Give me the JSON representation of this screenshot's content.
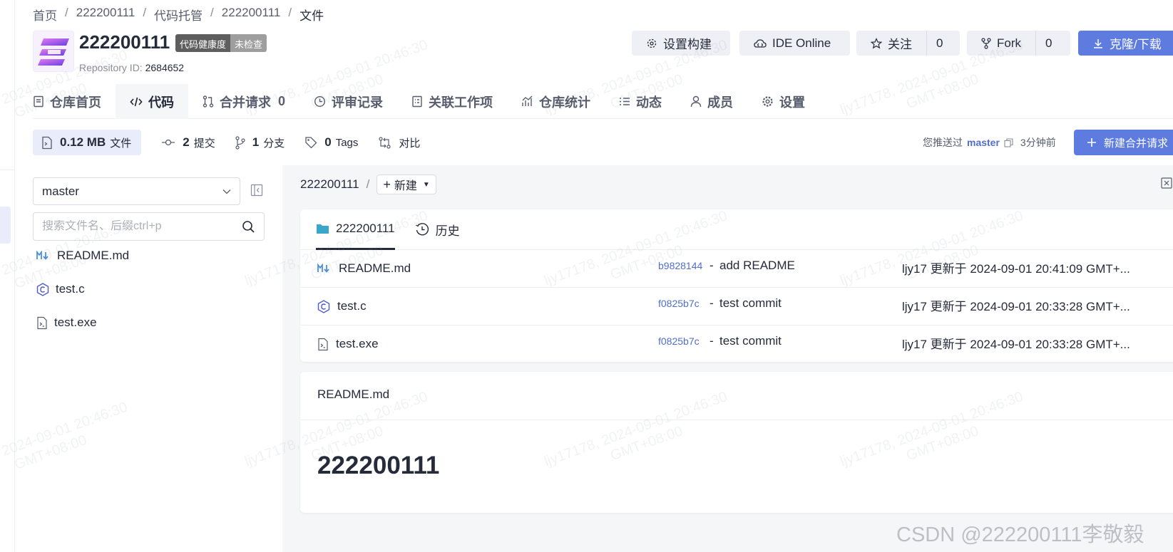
{
  "breadcrumb": [
    "首页",
    "222200111",
    "代码托管",
    "222200111",
    "文件"
  ],
  "repo": {
    "name": "222200111",
    "badge_left": "代码健康度",
    "badge_right": "未检查",
    "id_label": "Repository ID:",
    "id_value": "2684652"
  },
  "actions": {
    "build": "设置构建",
    "ide": "IDE Online",
    "watch": "关注",
    "watch_count": "0",
    "fork": "Fork",
    "fork_count": "0",
    "clone": "克隆/下载"
  },
  "tabs": [
    {
      "label": "仓库首页"
    },
    {
      "label": "代码"
    },
    {
      "label": "合并请求",
      "count": "0"
    },
    {
      "label": "评审记录"
    },
    {
      "label": "关联工作项"
    },
    {
      "label": "仓库统计"
    },
    {
      "label": "动态"
    },
    {
      "label": "成员"
    },
    {
      "label": "设置"
    }
  ],
  "stats": {
    "size": "0.12 MB",
    "size_label": "文件",
    "commits": "2",
    "commits_label": "提交",
    "branches": "1",
    "branches_label": "分支",
    "tags": "0",
    "tags_label": "Tags",
    "compare": "对比"
  },
  "push_info": {
    "prefix": "您推送过",
    "branch": "master",
    "time": "3分钟前"
  },
  "new_mr": "新建合并请求",
  "sidebar": {
    "branch": "master",
    "search_placeholder": "搜索文件名、后缀ctrl+p",
    "files": [
      "README.md",
      "test.c",
      "test.exe"
    ]
  },
  "main": {
    "path_root": "222200111",
    "new_label": "新建",
    "tab_folder": "222200111",
    "tab_history": "历史",
    "rows": [
      {
        "name": "README.md",
        "sha": "b9828144",
        "msg": "add README",
        "meta": "ljy17 更新于 2024-09-01 20:41:09 GMT+..."
      },
      {
        "name": "test.c",
        "sha": "f0825b7c",
        "msg": "test commit",
        "meta": "ljy17 更新于 2024-09-01 20:33:28 GMT+..."
      },
      {
        "name": "test.exe",
        "sha": "f0825b7c",
        "msg": "test commit",
        "meta": "ljy17 更新于 2024-09-01 20:33:28 GMT+..."
      }
    ],
    "readme_title": "README.md",
    "readme_h1": "222200111"
  },
  "watermark_date": "2024-09-01 20:46:30",
  "watermark_user": "ljy17178,",
  "watermark_tz": "GMT+08:00",
  "csdn": "CSDN @222200111李敬毅",
  "colors": {
    "accent": "#5e7ce0",
    "link": "#526ecc",
    "text": "#252b3a",
    "muted": "#575d6c"
  }
}
